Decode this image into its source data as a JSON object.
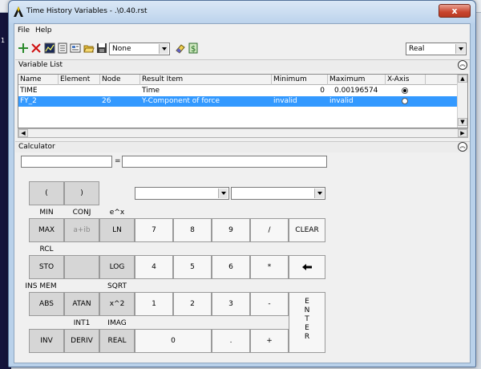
{
  "background": {
    "left_strip_text": "1"
  },
  "window": {
    "title": "Time History Variables - .\\0.40.rst",
    "close_glyph": "x"
  },
  "menu": {
    "file": "File",
    "help": "Help"
  },
  "toolbar": {
    "filter_select": "None",
    "mode_select": "Real"
  },
  "variable_list": {
    "title": "Variable List",
    "columns": [
      "Name",
      "Element",
      "Node",
      "Result Item",
      "Minimum",
      "Maximum",
      "X-Axis"
    ],
    "rows": [
      {
        "name": "TIME",
        "element": "",
        "node": "",
        "result_item": "Time",
        "minimum": "0",
        "maximum": "0.00196574",
        "x_axis": true,
        "selected": false
      },
      {
        "name": "FY_2",
        "element": "",
        "node": "26",
        "result_item": "Y-Component of force",
        "minimum": "invalid",
        "maximum": "invalid",
        "x_axis": false,
        "selected": true
      }
    ]
  },
  "calculator": {
    "title": "Calculator",
    "equals": "=",
    "labels": {
      "min": "MIN",
      "conj": "CONJ",
      "e_x": "e^x",
      "rcl": "RCL",
      "ins_mem": "INS MEM",
      "sqrt": "SQRT",
      "int1": "INT1",
      "imag": "IMAG"
    },
    "buttons": {
      "lparen": "(",
      "rparen": ")",
      "max": "MAX",
      "aib": "a+ib",
      "ln": "LN",
      "sto": "STO",
      "log": "LOG",
      "abs": "ABS",
      "atan": "ATAN",
      "x2": "x^2",
      "inv": "INV",
      "deriv": "DERIV",
      "real": "REAL",
      "d7": "7",
      "d8": "8",
      "d9": "9",
      "div": "/",
      "clear": "CLEAR",
      "d4": "4",
      "d5": "5",
      "d6": "6",
      "mul": "*",
      "d1": "1",
      "d2": "2",
      "d3": "3",
      "sub": "-",
      "d0": "0",
      "dot": ".",
      "add": "+",
      "enter": [
        "E",
        "N",
        "T",
        "E",
        "R"
      ]
    }
  }
}
